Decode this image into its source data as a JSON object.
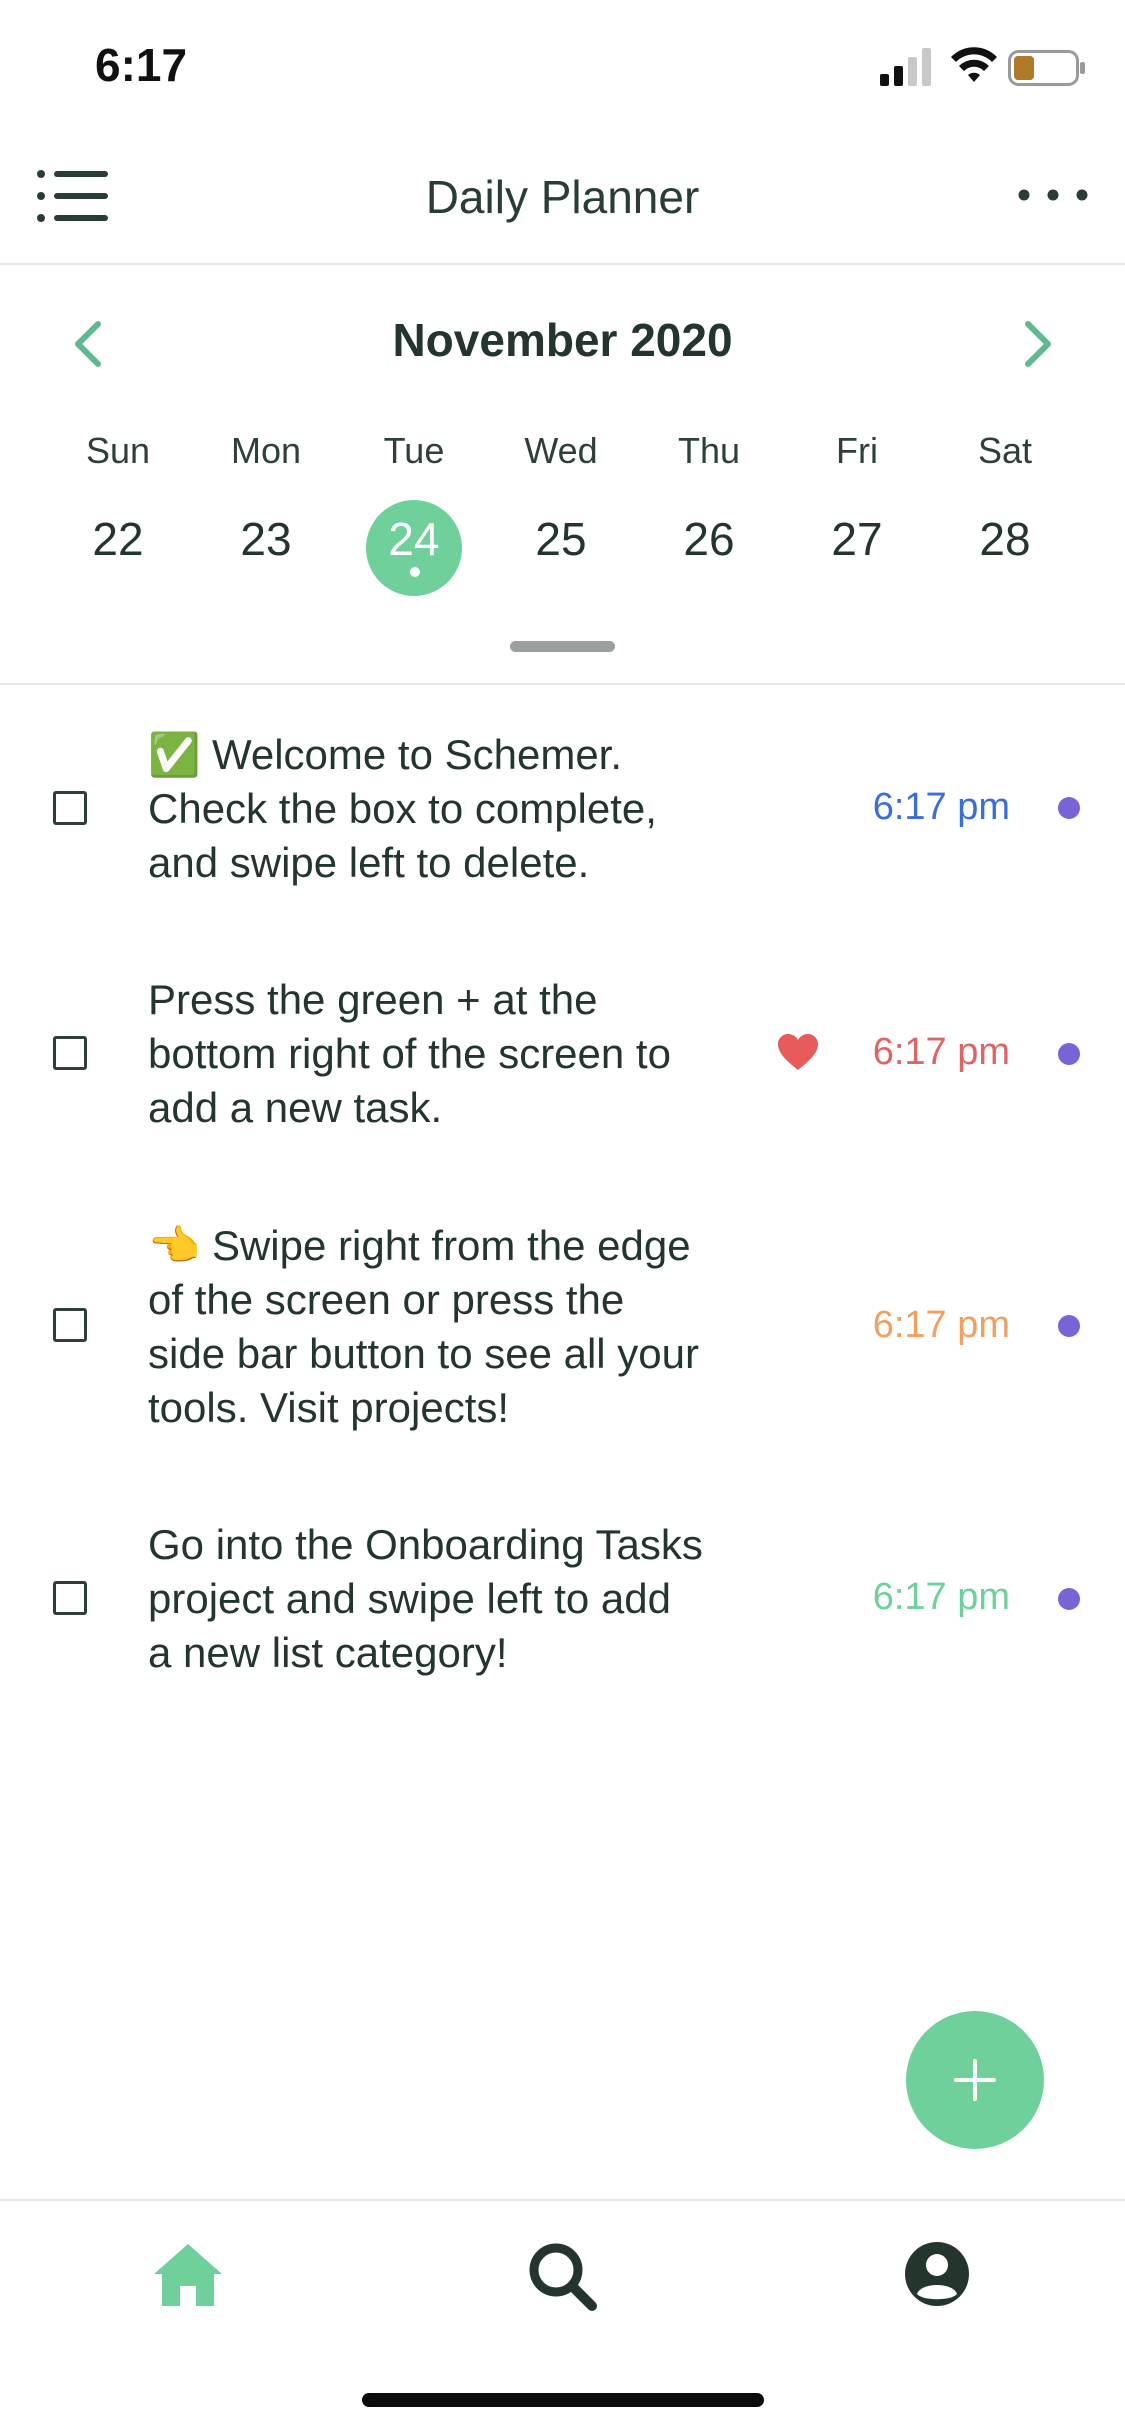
{
  "status_bar": {
    "time": "6:17"
  },
  "header": {
    "title": "Daily Planner"
  },
  "calendar": {
    "month": "November 2020",
    "days": [
      {
        "name": "Sun",
        "number": "22",
        "selected": false
      },
      {
        "name": "Mon",
        "number": "23",
        "selected": false
      },
      {
        "name": "Tue",
        "number": "24",
        "selected": true
      },
      {
        "name": "Wed",
        "number": "25",
        "selected": false
      },
      {
        "name": "Thu",
        "number": "26",
        "selected": false
      },
      {
        "name": "Fri",
        "number": "27",
        "selected": false
      },
      {
        "name": "Sat",
        "number": "28",
        "selected": false
      }
    ]
  },
  "tasks": [
    {
      "lines": [
        "✅ Welcome to Schemer.",
        "Check the box to complete,",
        "and swipe left to delete."
      ],
      "time": "6:17 pm",
      "time_color": "#3a6fd8",
      "checked": false,
      "favorite": false
    },
    {
      "lines": [
        "Press the green +  at the",
        "bottom right of the screen to",
        "add a new task."
      ],
      "time": "6:17 pm",
      "time_color": "#e06464",
      "checked": false,
      "favorite": true
    },
    {
      "lines": [
        "👈 Swipe right from the edge",
        "of the screen or press the",
        "side bar button to see all your",
        "tools. Visit projects!"
      ],
      "time": "6:17 pm",
      "time_color": "#f0a060",
      "checked": false,
      "favorite": false
    },
    {
      "lines": [
        "Go into the Onboarding Tasks",
        "project and swipe left to add",
        "a new list category!"
      ],
      "time": "6:17 pm",
      "time_color": "#6fd09c",
      "checked": false,
      "favorite": false
    }
  ],
  "colors": {
    "accent": "#6fd09c",
    "text": "#24352e",
    "task_dot": "#7a63d6",
    "heart": "#e85b5b"
  },
  "tab_bar": {
    "items": [
      {
        "icon": "home-icon",
        "active": true
      },
      {
        "icon": "search-icon",
        "active": false
      },
      {
        "icon": "profile-icon",
        "active": false
      }
    ]
  }
}
